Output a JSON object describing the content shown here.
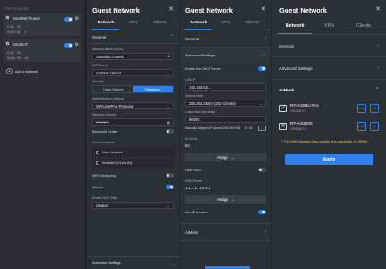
{
  "profile": {
    "header": "PROFILE LIST",
    "cards": [
      {
        "title": "SmartNETGuest",
        "ghz": "2.4G",
        "ghz5": "5G",
        "vlan": "VLAN: 52",
        "num": "2"
      },
      {
        "title": "SmartIoT",
        "ghz": "2.4G",
        "ghz5": "5G",
        "vlan": "VLAN: 53",
        "num": "16"
      }
    ],
    "add_label": "Add a Network"
  },
  "panel1": {
    "title": "Guest Network",
    "tabs": [
      "Network",
      "VPN",
      "Clients"
    ],
    "general_label": "General",
    "name_label": "Network Name (SSID)",
    "name_value": "SmartNETGuest",
    "band_label": "WiFi Band",
    "band_value": "2.4GHz / 5GHz",
    "security_label": "Security",
    "security_options": [
      "Open System",
      "Password"
    ],
    "auth_label": "Authentication Method",
    "auth_value": "WPA2/WPA3-Personal",
    "wpass_label": "Wireless Security",
    "wpass_value": "••••••••••",
    "bandwidth_label": "Bandwidth Limiter",
    "access_label": "Access Intranet",
    "main_net": "Main Network",
    "iot_net": "SmartIoT (VLAN 53)",
    "wifi_sched_label": "WiFi Scheduling",
    "aimesh_label": "AiMesh",
    "mac_label": "Enable MAC Filter",
    "mac_value": "Disable",
    "advanced_label": "Advanced Settings"
  },
  "panel2": {
    "title": "Guest Network",
    "tabs": [
      "Network",
      "VPN",
      "Clients"
    ],
    "general_label": "General",
    "adv_label": "Advanced Settings",
    "dhcp_label": "Enable the DHCP Server",
    "lanip_label": "LAN IP",
    "lanip_value": "192.168.52.1",
    "subnet_label": "Subnet Mask",
    "subnet_value": "255.255.255.0 (253 Clients)",
    "lease_label": "Lease time (seconds)",
    "lease_value": "86400",
    "maxip_label": "Manually Assigned IP around the DHCP list",
    "maxip_count": "0 / 32",
    "vlan_label": "VLAN ID",
    "vlan_value": "52",
    "assign_label": "Assign",
    "dns_toggle_label": "Hide SSID",
    "dns_label": "DNS Server",
    "dns_value": "1.1.1.1, 1.0.0.1",
    "ipv6_label": "Set AP Isolated",
    "aimesh_label": "AiMesh"
  },
  "panel3": {
    "title": "Guest Network",
    "tabs": [
      "Network",
      "VPN",
      "Clients"
    ],
    "general_label": "General",
    "adv_label": "Advanced Settings",
    "aimesh_label": "AiMesh",
    "nodes": [
      {
        "name": "RT-AX88U Pro",
        "ip": "192.168.0.1",
        "checked": "✓",
        "band1": "2.4G",
        "band2": "5G"
      },
      {
        "name": "RT-AX3000",
        "ip": "192.168.0.3",
        "checked": "✕",
        "band1": "2.4G",
        "band2": "5G"
      }
    ],
    "warning": "* The WiFi interface has reached the maximum. (2.4GHz)",
    "apply_label": "Apply"
  },
  "colors": {
    "accent": "#2f80ed",
    "warn": "#f2c94c",
    "bg": "#2b3035"
  }
}
